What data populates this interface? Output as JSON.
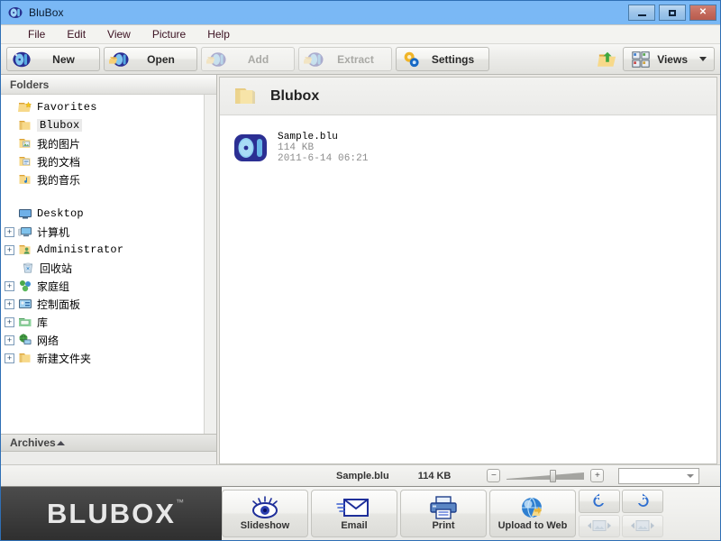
{
  "window": {
    "title": "BluBox",
    "icon": "blubox-app-icon",
    "controls": {
      "minimize": "Minimize",
      "maximize": "Maximize",
      "close": "Close"
    }
  },
  "menubar": {
    "items": [
      {
        "label": "File"
      },
      {
        "label": "Edit"
      },
      {
        "label": "View"
      },
      {
        "label": "Picture"
      },
      {
        "label": "Help"
      }
    ]
  },
  "toolbar": {
    "buttons": [
      {
        "label": "New",
        "icon": "blubox-new-icon",
        "disabled": false
      },
      {
        "label": "Open",
        "icon": "folder-open-icon",
        "disabled": false
      },
      {
        "label": "Add",
        "icon": "add-archive-icon",
        "disabled": true
      },
      {
        "label": "Extract",
        "icon": "extract-archive-icon",
        "disabled": true
      },
      {
        "label": "Settings",
        "icon": "gear-icon",
        "disabled": false
      }
    ],
    "upload_icon": "folder-upload-icon",
    "views": {
      "label": "Views",
      "icon": "views-grid-icon"
    }
  },
  "sidebar": {
    "folders_header": {
      "label": "Folders"
    },
    "tree": [
      {
        "label": "Favorites",
        "icon": "favorites-folder-icon",
        "indent": 0,
        "expander": "none",
        "mono": true,
        "selected": false
      },
      {
        "label": "Blubox",
        "icon": "folder-icon",
        "indent": 1,
        "expander": "none",
        "mono": true,
        "selected": true
      },
      {
        "label": "我的图片",
        "icon": "pictures-folder-icon",
        "indent": 1,
        "expander": "none",
        "mono": false,
        "selected": false
      },
      {
        "label": "我的文档",
        "icon": "documents-folder-icon",
        "indent": 1,
        "expander": "none",
        "mono": false,
        "selected": false
      },
      {
        "label": "我的音乐",
        "icon": "music-folder-icon",
        "indent": 1,
        "expander": "none",
        "mono": false,
        "selected": false
      },
      {
        "label": "",
        "icon": "spacer",
        "indent": 0,
        "expander": "gap",
        "mono": false,
        "selected": false
      },
      {
        "label": "Desktop",
        "icon": "desktop-icon",
        "indent": 0,
        "expander": "none",
        "mono": true,
        "selected": false
      },
      {
        "label": "计算机",
        "icon": "computer-icon",
        "indent": 0,
        "expander": "plus",
        "mono": false,
        "selected": false
      },
      {
        "label": "Administrator",
        "icon": "user-folder-icon",
        "indent": 0,
        "expander": "plus",
        "mono": true,
        "selected": false
      },
      {
        "label": "回收站",
        "icon": "recycle-bin-icon",
        "indent": 0,
        "expander": "none",
        "mono": false,
        "selected": false
      },
      {
        "label": "家庭组",
        "icon": "homegroup-icon",
        "indent": 0,
        "expander": "plus",
        "mono": false,
        "selected": false
      },
      {
        "label": "控制面板",
        "icon": "control-panel-icon",
        "indent": 0,
        "expander": "plus",
        "mono": false,
        "selected": false
      },
      {
        "label": "库",
        "icon": "library-icon",
        "indent": 0,
        "expander": "plus",
        "mono": false,
        "selected": false
      },
      {
        "label": "网络",
        "icon": "network-icon",
        "indent": 0,
        "expander": "plus",
        "mono": false,
        "selected": false
      },
      {
        "label": "新建文件夹",
        "icon": "folder-icon",
        "indent": 0,
        "expander": "plus",
        "mono": false,
        "selected": false
      }
    ],
    "expander_symbol": "+",
    "archives_header": {
      "label": "Archives",
      "chevron": "chevron-up-icon"
    }
  },
  "main": {
    "breadcrumb": {
      "label": "Blubox",
      "icon": "folder-icon"
    },
    "files": [
      {
        "name": "Sample.blu",
        "size": "114 KB",
        "date": "2011-6-14 06:21",
        "icon": "blu-file-icon"
      }
    ]
  },
  "statusbar": {
    "file_name": "Sample.blu",
    "file_size": "114 KB",
    "zoom_out": "−",
    "zoom_in": "+",
    "zoom_position_pct": 56,
    "dropdown_value": ""
  },
  "actionbar": {
    "brand": "BLUBOX",
    "brand_tm": "™",
    "buttons": [
      {
        "label": "Slideshow",
        "icon": "eye-icon"
      },
      {
        "label": "Email",
        "icon": "envelope-icon"
      },
      {
        "label": "Print",
        "icon": "printer-icon"
      },
      {
        "label": "Upload to Web",
        "icon": "globe-upload-icon"
      }
    ],
    "small_buttons": [
      {
        "name": "rotate-left",
        "icon": "rotate-left-icon",
        "disabled": false
      },
      {
        "name": "rotate-right",
        "icon": "rotate-right-icon",
        "disabled": false
      },
      {
        "name": "prev-image",
        "icon": "prev-image-icon",
        "disabled": true
      },
      {
        "name": "next-image",
        "icon": "next-image-icon",
        "disabled": true
      }
    ]
  },
  "colors": {
    "window_frame": "#6aaef0",
    "titlebar_text": "#0a1a2e",
    "close_button": "#c46a5c",
    "accent_blue": "#2a3f9d",
    "toolbar_bg": "#ebebe8",
    "actionbar_bg": "#3a3a3a"
  }
}
